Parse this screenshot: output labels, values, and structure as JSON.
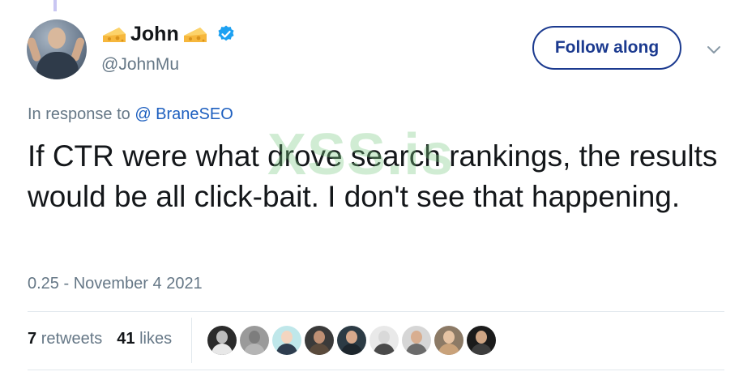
{
  "author": {
    "display_name": "John",
    "name_emoji": "cheese-wedge-icon",
    "handle": "@JohnMu",
    "verified": true
  },
  "follow_button": {
    "label": "Follow along"
  },
  "menu": {
    "icon": "chevron-down-icon"
  },
  "reply": {
    "prefix": "In response to",
    "mention": "@ BraneSEO"
  },
  "tweet": {
    "text": "If CTR were what drove search rankings, the results would be all click-bait. I don't see that happening.",
    "timestamp": "0.25 - November 4 2021"
  },
  "watermark": {
    "text": "XSS.is"
  },
  "stats": {
    "retweets_count": "7",
    "retweets_label": "retweets",
    "likes_count": "41",
    "likes_label": "likes"
  },
  "likers": [
    {
      "name": "liker-1",
      "bg": "#2b2b2b",
      "face": "#bdbdbd",
      "shoulders": "#e8e8e8"
    },
    {
      "name": "liker-2",
      "bg": "#9a9a9a",
      "face": "#7d7d7d",
      "shoulders": "#b5b5b5"
    },
    {
      "name": "liker-3",
      "bg": "#bfe7ea",
      "face": "#f3d5c0",
      "shoulders": "#2e3d4f"
    },
    {
      "name": "liker-4",
      "bg": "#3a3a3a",
      "face": "#c09074",
      "shoulders": "#5a4a3c"
    },
    {
      "name": "liker-5",
      "bg": "#2c3b45",
      "face": "#d7a98c",
      "shoulders": "#1d262d"
    },
    {
      "name": "liker-6",
      "bg": "#e9e9e9",
      "face": "#d9d9d9",
      "shoulders": "#4a4a4a"
    },
    {
      "name": "liker-7",
      "bg": "#d6d6d6",
      "face": "#d8ae90",
      "shoulders": "#6b6b6b"
    },
    {
      "name": "liker-8",
      "bg": "#8c7a66",
      "face": "#e6c3a3",
      "shoulders": "#c9a27a"
    },
    {
      "name": "liker-9",
      "bg": "#1b1b1b",
      "face": "#cfa584",
      "shoulders": "#3d3d3d"
    }
  ],
  "colors": {
    "accent": "#1b3a8f",
    "link": "#1d5fbf",
    "verified": "#1da1f2",
    "muted": "#657786"
  }
}
